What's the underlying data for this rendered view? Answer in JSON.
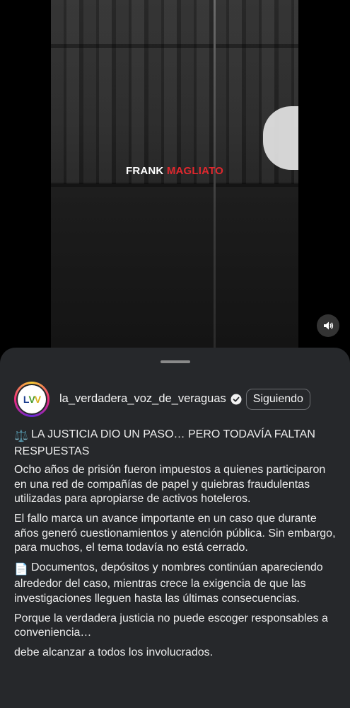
{
  "video": {
    "caption_first": "FRANK",
    "caption_last": "MAGLIATO",
    "audio_icon": "speaker-icon"
  },
  "post": {
    "username": "la_verdadera_voz_de_veraguas",
    "verified_icon": "verified-badge-icon",
    "follow_label": "Siguiendo",
    "avatar_letters": [
      "L",
      "V",
      "V"
    ],
    "heading_emoji": "⚖️",
    "heading": "LA JUSTICIA DIO UN PASO… PERO TODAVÍA FALTAN RESPUESTAS",
    "paragraph_1": "Ocho años de prisión fueron impuestos a quienes participaron en una red de compañías de papel y quiebras fraudulentas utilizadas para apropiarse de activos hoteleros.",
    "paragraph_2": "El fallo marca un avance importante en un caso que durante años generó cuestionamientos y atención pública. Sin embargo, para muchos, el tema todavía no está cerrado.",
    "paragraph_3_emoji": "📄",
    "paragraph_3": "Documentos, depósitos y nombres continúan apareciendo alrededor del caso, mientras crece la exigencia de que las investigaciones lleguen hasta las últimas consecuencias.",
    "paragraph_4": "Porque la verdadera justicia no puede escoger responsables a conveniencia…",
    "paragraph_5": "debe alcanzar a todos los involucrados."
  },
  "colors": {
    "caption_highlight": "#e0282e",
    "sheet_background": "#26282b"
  }
}
